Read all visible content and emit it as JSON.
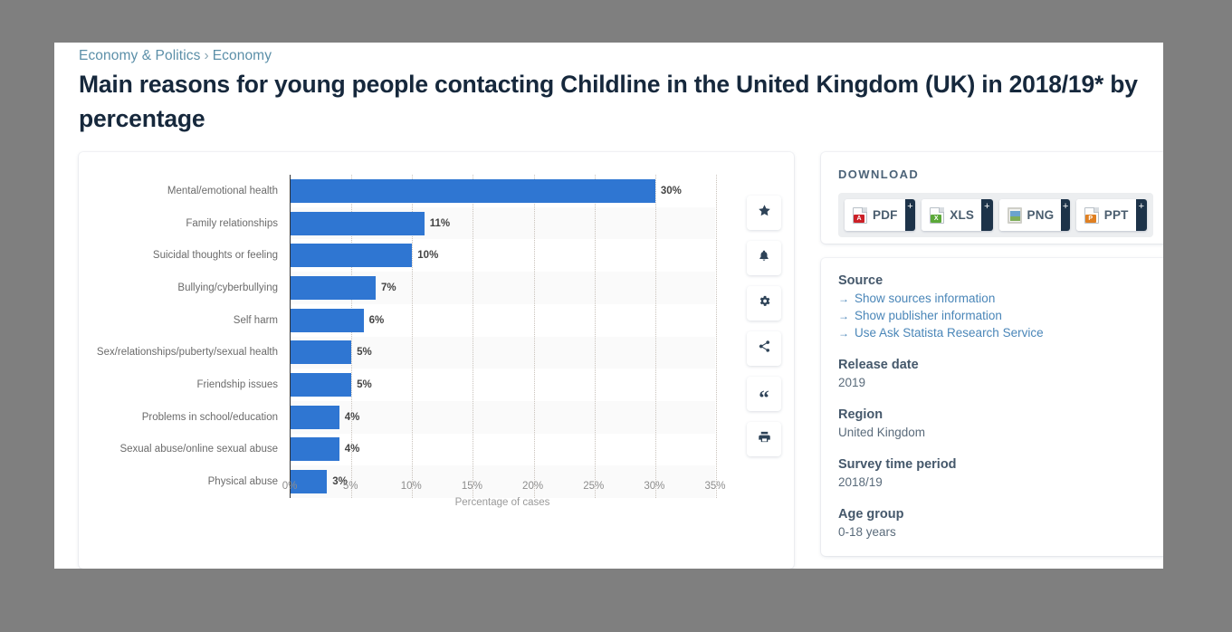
{
  "breadcrumb": {
    "items": [
      "Economy & Politics",
      "Economy"
    ],
    "separator": "›"
  },
  "title": "Main reasons for young people contacting Childline in the United Kingdom (UK) in 2018/19* by percentage",
  "chart_data": {
    "type": "bar",
    "orientation": "horizontal",
    "title": "",
    "xlabel": "Percentage of cases",
    "ylabel": "",
    "xlim": [
      0,
      35
    ],
    "xticks": [
      "0%",
      "5%",
      "10%",
      "15%",
      "20%",
      "25%",
      "30%",
      "35%"
    ],
    "xtick_values": [
      0,
      5,
      10,
      15,
      20,
      25,
      30,
      35
    ],
    "grid": true,
    "legend": "none",
    "bar_color": "#2f76d2",
    "categories": [
      "Mental/emotional health",
      "Family relationships",
      "Suicidal thoughts or feeling",
      "Bullying/cyberbullying",
      "Self harm",
      "Sex/relationships/puberty/sexual health",
      "Friendship issues",
      "Problems in school/education",
      "Sexual abuse/online sexual abuse",
      "Physical abuse"
    ],
    "values": [
      30,
      11,
      10,
      7,
      6,
      5,
      5,
      4,
      4,
      3
    ],
    "data_labels": [
      "30%",
      "11%",
      "10%",
      "7%",
      "6%",
      "5%",
      "5%",
      "4%",
      "4%",
      "3%"
    ]
  },
  "toolbar": {
    "items": [
      {
        "name": "favorite",
        "icon": "star-icon"
      },
      {
        "name": "alert",
        "icon": "bell-icon"
      },
      {
        "name": "settings",
        "icon": "gear-icon"
      },
      {
        "name": "share",
        "icon": "share-icon"
      },
      {
        "name": "cite",
        "icon": "quote-icon"
      },
      {
        "name": "print",
        "icon": "print-icon"
      }
    ],
    "quote_glyph": "“"
  },
  "download": {
    "heading": "DOWNLOAD",
    "plus_label": "+",
    "buttons": [
      {
        "label": "PDF",
        "type": "pdf",
        "tag": "A"
      },
      {
        "label": "XLS",
        "type": "xls",
        "tag": "X"
      },
      {
        "label": "PNG",
        "type": "png",
        "tag": ""
      },
      {
        "label": "PPT",
        "type": "ppt",
        "tag": "P"
      }
    ]
  },
  "info": {
    "source_heading": "Source",
    "links": [
      "Show sources information",
      "Show publisher information",
      "Use Ask Statista Research Service"
    ],
    "arrow": "→",
    "release_date_heading": "Release date",
    "release_date_value": "2019",
    "region_heading": "Region",
    "region_value": "United Kingdom",
    "survey_heading": "Survey time period",
    "survey_value": "2018/19",
    "age_heading": "Age group",
    "age_value": "0-18 years"
  },
  "colors": {
    "page_background": "#7f7f7f",
    "accent_blue": "#2f76d2",
    "link_blue": "#4a86b8",
    "heading_dark": "#16283c"
  }
}
